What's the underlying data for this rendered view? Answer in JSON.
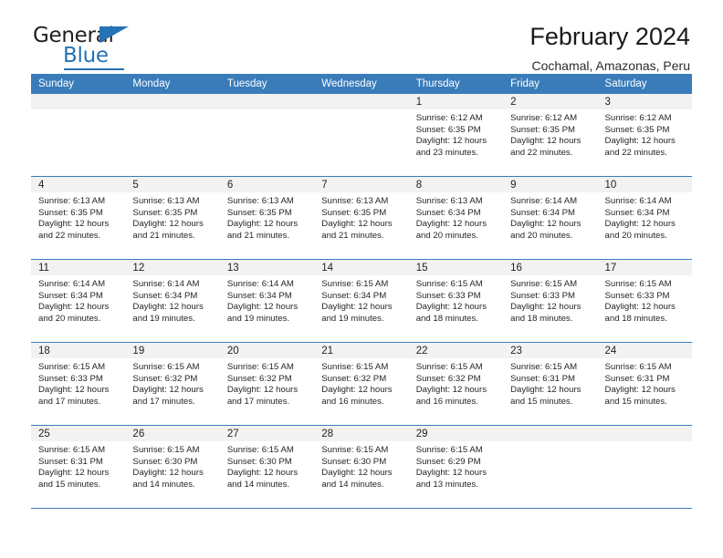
{
  "brand": {
    "name_part1": "General",
    "name_part2": "Blue",
    "accent_color": "#2572b6"
  },
  "header": {
    "title": "February 2024",
    "subtitle": "Cochamal, Amazonas, Peru"
  },
  "calendar": {
    "header_bg": "#3a7cba",
    "daynum_bg": "#f2f2f2",
    "weekdays": [
      "Sunday",
      "Monday",
      "Tuesday",
      "Wednesday",
      "Thursday",
      "Friday",
      "Saturday"
    ],
    "weeks": [
      [
        {
          "day": "",
          "sunrise": "",
          "sunset": "",
          "daylight_line1": "",
          "daylight_line2": ""
        },
        {
          "day": "",
          "sunrise": "",
          "sunset": "",
          "daylight_line1": "",
          "daylight_line2": ""
        },
        {
          "day": "",
          "sunrise": "",
          "sunset": "",
          "daylight_line1": "",
          "daylight_line2": ""
        },
        {
          "day": "",
          "sunrise": "",
          "sunset": "",
          "daylight_line1": "",
          "daylight_line2": ""
        },
        {
          "day": "1",
          "sunrise": "Sunrise: 6:12 AM",
          "sunset": "Sunset: 6:35 PM",
          "daylight_line1": "Daylight: 12 hours",
          "daylight_line2": "and 23 minutes."
        },
        {
          "day": "2",
          "sunrise": "Sunrise: 6:12 AM",
          "sunset": "Sunset: 6:35 PM",
          "daylight_line1": "Daylight: 12 hours",
          "daylight_line2": "and 22 minutes."
        },
        {
          "day": "3",
          "sunrise": "Sunrise: 6:12 AM",
          "sunset": "Sunset: 6:35 PM",
          "daylight_line1": "Daylight: 12 hours",
          "daylight_line2": "and 22 minutes."
        }
      ],
      [
        {
          "day": "4",
          "sunrise": "Sunrise: 6:13 AM",
          "sunset": "Sunset: 6:35 PM",
          "daylight_line1": "Daylight: 12 hours",
          "daylight_line2": "and 22 minutes."
        },
        {
          "day": "5",
          "sunrise": "Sunrise: 6:13 AM",
          "sunset": "Sunset: 6:35 PM",
          "daylight_line1": "Daylight: 12 hours",
          "daylight_line2": "and 21 minutes."
        },
        {
          "day": "6",
          "sunrise": "Sunrise: 6:13 AM",
          "sunset": "Sunset: 6:35 PM",
          "daylight_line1": "Daylight: 12 hours",
          "daylight_line2": "and 21 minutes."
        },
        {
          "day": "7",
          "sunrise": "Sunrise: 6:13 AM",
          "sunset": "Sunset: 6:35 PM",
          "daylight_line1": "Daylight: 12 hours",
          "daylight_line2": "and 21 minutes."
        },
        {
          "day": "8",
          "sunrise": "Sunrise: 6:13 AM",
          "sunset": "Sunset: 6:34 PM",
          "daylight_line1": "Daylight: 12 hours",
          "daylight_line2": "and 20 minutes."
        },
        {
          "day": "9",
          "sunrise": "Sunrise: 6:14 AM",
          "sunset": "Sunset: 6:34 PM",
          "daylight_line1": "Daylight: 12 hours",
          "daylight_line2": "and 20 minutes."
        },
        {
          "day": "10",
          "sunrise": "Sunrise: 6:14 AM",
          "sunset": "Sunset: 6:34 PM",
          "daylight_line1": "Daylight: 12 hours",
          "daylight_line2": "and 20 minutes."
        }
      ],
      [
        {
          "day": "11",
          "sunrise": "Sunrise: 6:14 AM",
          "sunset": "Sunset: 6:34 PM",
          "daylight_line1": "Daylight: 12 hours",
          "daylight_line2": "and 20 minutes."
        },
        {
          "day": "12",
          "sunrise": "Sunrise: 6:14 AM",
          "sunset": "Sunset: 6:34 PM",
          "daylight_line1": "Daylight: 12 hours",
          "daylight_line2": "and 19 minutes."
        },
        {
          "day": "13",
          "sunrise": "Sunrise: 6:14 AM",
          "sunset": "Sunset: 6:34 PM",
          "daylight_line1": "Daylight: 12 hours",
          "daylight_line2": "and 19 minutes."
        },
        {
          "day": "14",
          "sunrise": "Sunrise: 6:15 AM",
          "sunset": "Sunset: 6:34 PM",
          "daylight_line1": "Daylight: 12 hours",
          "daylight_line2": "and 19 minutes."
        },
        {
          "day": "15",
          "sunrise": "Sunrise: 6:15 AM",
          "sunset": "Sunset: 6:33 PM",
          "daylight_line1": "Daylight: 12 hours",
          "daylight_line2": "and 18 minutes."
        },
        {
          "day": "16",
          "sunrise": "Sunrise: 6:15 AM",
          "sunset": "Sunset: 6:33 PM",
          "daylight_line1": "Daylight: 12 hours",
          "daylight_line2": "and 18 minutes."
        },
        {
          "day": "17",
          "sunrise": "Sunrise: 6:15 AM",
          "sunset": "Sunset: 6:33 PM",
          "daylight_line1": "Daylight: 12 hours",
          "daylight_line2": "and 18 minutes."
        }
      ],
      [
        {
          "day": "18",
          "sunrise": "Sunrise: 6:15 AM",
          "sunset": "Sunset: 6:33 PM",
          "daylight_line1": "Daylight: 12 hours",
          "daylight_line2": "and 17 minutes."
        },
        {
          "day": "19",
          "sunrise": "Sunrise: 6:15 AM",
          "sunset": "Sunset: 6:32 PM",
          "daylight_line1": "Daylight: 12 hours",
          "daylight_line2": "and 17 minutes."
        },
        {
          "day": "20",
          "sunrise": "Sunrise: 6:15 AM",
          "sunset": "Sunset: 6:32 PM",
          "daylight_line1": "Daylight: 12 hours",
          "daylight_line2": "and 17 minutes."
        },
        {
          "day": "21",
          "sunrise": "Sunrise: 6:15 AM",
          "sunset": "Sunset: 6:32 PM",
          "daylight_line1": "Daylight: 12 hours",
          "daylight_line2": "and 16 minutes."
        },
        {
          "day": "22",
          "sunrise": "Sunrise: 6:15 AM",
          "sunset": "Sunset: 6:32 PM",
          "daylight_line1": "Daylight: 12 hours",
          "daylight_line2": "and 16 minutes."
        },
        {
          "day": "23",
          "sunrise": "Sunrise: 6:15 AM",
          "sunset": "Sunset: 6:31 PM",
          "daylight_line1": "Daylight: 12 hours",
          "daylight_line2": "and 15 minutes."
        },
        {
          "day": "24",
          "sunrise": "Sunrise: 6:15 AM",
          "sunset": "Sunset: 6:31 PM",
          "daylight_line1": "Daylight: 12 hours",
          "daylight_line2": "and 15 minutes."
        }
      ],
      [
        {
          "day": "25",
          "sunrise": "Sunrise: 6:15 AM",
          "sunset": "Sunset: 6:31 PM",
          "daylight_line1": "Daylight: 12 hours",
          "daylight_line2": "and 15 minutes."
        },
        {
          "day": "26",
          "sunrise": "Sunrise: 6:15 AM",
          "sunset": "Sunset: 6:30 PM",
          "daylight_line1": "Daylight: 12 hours",
          "daylight_line2": "and 14 minutes."
        },
        {
          "day": "27",
          "sunrise": "Sunrise: 6:15 AM",
          "sunset": "Sunset: 6:30 PM",
          "daylight_line1": "Daylight: 12 hours",
          "daylight_line2": "and 14 minutes."
        },
        {
          "day": "28",
          "sunrise": "Sunrise: 6:15 AM",
          "sunset": "Sunset: 6:30 PM",
          "daylight_line1": "Daylight: 12 hours",
          "daylight_line2": "and 14 minutes."
        },
        {
          "day": "29",
          "sunrise": "Sunrise: 6:15 AM",
          "sunset": "Sunset: 6:29 PM",
          "daylight_line1": "Daylight: 12 hours",
          "daylight_line2": "and 13 minutes."
        },
        {
          "day": "",
          "sunrise": "",
          "sunset": "",
          "daylight_line1": "",
          "daylight_line2": ""
        },
        {
          "day": "",
          "sunrise": "",
          "sunset": "",
          "daylight_line1": "",
          "daylight_line2": ""
        }
      ]
    ]
  }
}
